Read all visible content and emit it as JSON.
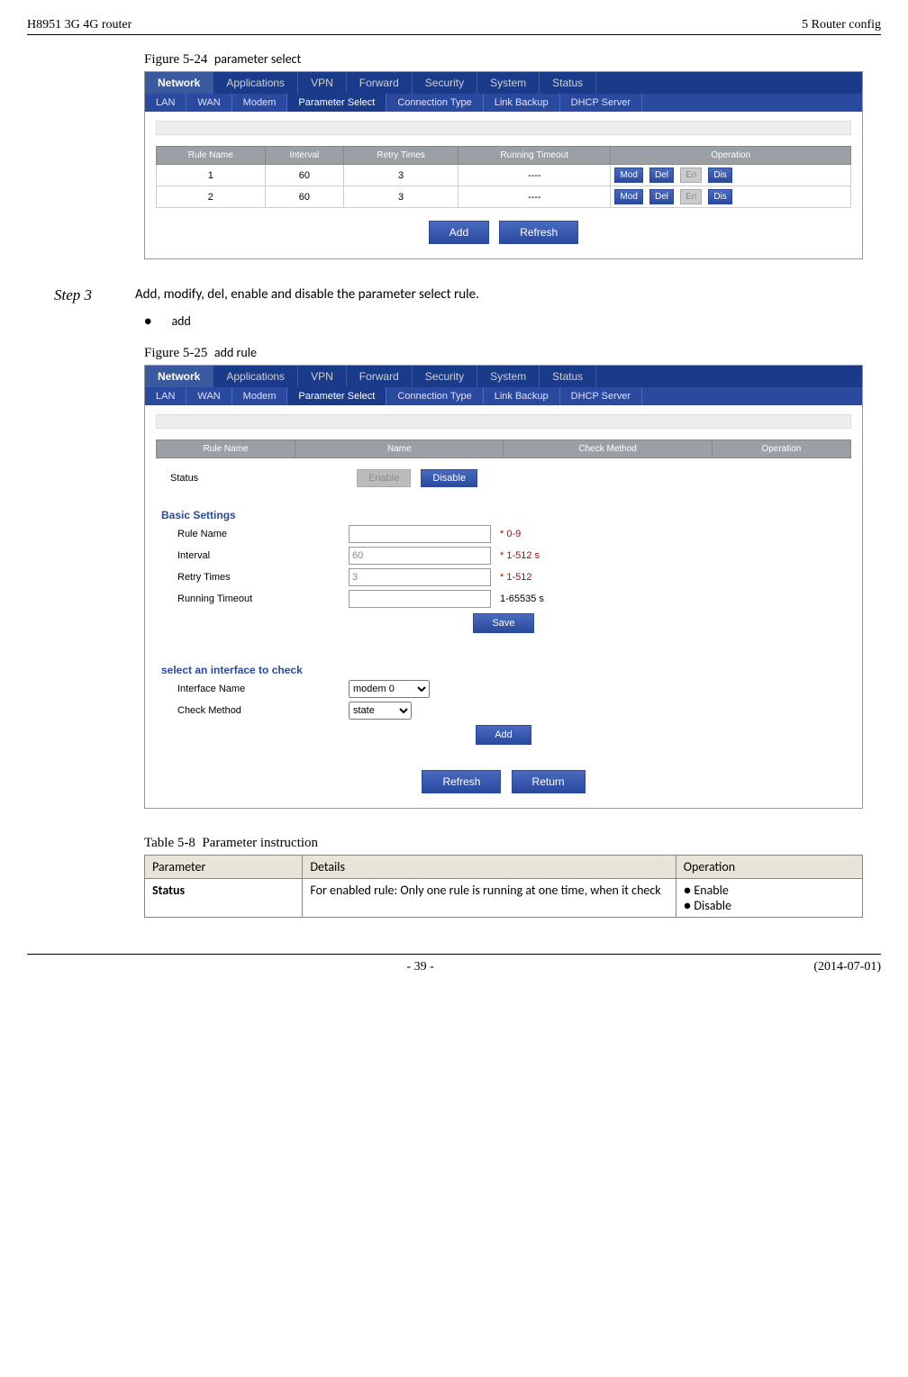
{
  "header": {
    "left": "H8951 3G 4G router",
    "right": "5  Router config"
  },
  "fig524": {
    "label": "Figure 5-24",
    "title": "parameter select"
  },
  "ui1": {
    "mainTabs": [
      "Network",
      "Applications",
      "VPN",
      "Forward",
      "Security",
      "System",
      "Status"
    ],
    "subTabs": [
      "LAN",
      "WAN",
      "Modem",
      "Parameter Select",
      "Connection Type",
      "Link Backup",
      "DHCP Server"
    ],
    "cols": [
      "Rule Name",
      "Interval",
      "Retry Times",
      "Running Timeout",
      "Operation"
    ],
    "rows": [
      {
        "name": "1",
        "interval": "60",
        "retry": "3",
        "timeout": "----"
      },
      {
        "name": "2",
        "interval": "60",
        "retry": "3",
        "timeout": "----"
      }
    ],
    "opbtns": {
      "mod": "Mod",
      "del": "Del",
      "en": "En",
      "dis": "Dis"
    },
    "btns": {
      "add": "Add",
      "refresh": "Refresh"
    }
  },
  "step3": {
    "label": "Step 3",
    "text": "Add, modify, del, enable and disable the parameter select rule."
  },
  "bullet_add": "add",
  "fig525": {
    "label": "Figure 5-25",
    "title": "add rule"
  },
  "ui2": {
    "hdrCols": [
      "Rule Name",
      "Name",
      "Check Method",
      "Operation"
    ],
    "statusLabel": "Status",
    "statusBtns": {
      "enable": "Enable",
      "disable": "Disable"
    },
    "fs1": {
      "legend": "Basic Settings",
      "rows": [
        {
          "label": "Rule Name",
          "value": "",
          "hint": "* 0-9",
          "red": true
        },
        {
          "label": "Interval",
          "value": "60",
          "hint": "* 1-512 s",
          "red": true
        },
        {
          "label": "Retry Times",
          "value": "3",
          "hint": "* 1-512",
          "red": true
        },
        {
          "label": "Running Timeout",
          "value": "",
          "hint": "1-65535 s",
          "red": false
        }
      ],
      "save": "Save"
    },
    "fs2": {
      "legend": "select an interface to check",
      "iface": {
        "label": "Interface Name",
        "value": "modem 0"
      },
      "method": {
        "label": "Check Method",
        "value": "state"
      },
      "add": "Add"
    },
    "bottom": {
      "refresh": "Refresh",
      "return": "Return"
    }
  },
  "table58": {
    "label": "Table 5-8",
    "title": "Parameter instruction",
    "head": [
      "Parameter",
      "Details",
      "Operation"
    ],
    "row": {
      "param": "Status",
      "details": "For enabled rule: Only one rule is running at one time, when it check",
      "ops": [
        "Enable",
        "Disable"
      ]
    }
  },
  "footer": {
    "page": "- 39 -",
    "date": "(2014-07-01)"
  }
}
